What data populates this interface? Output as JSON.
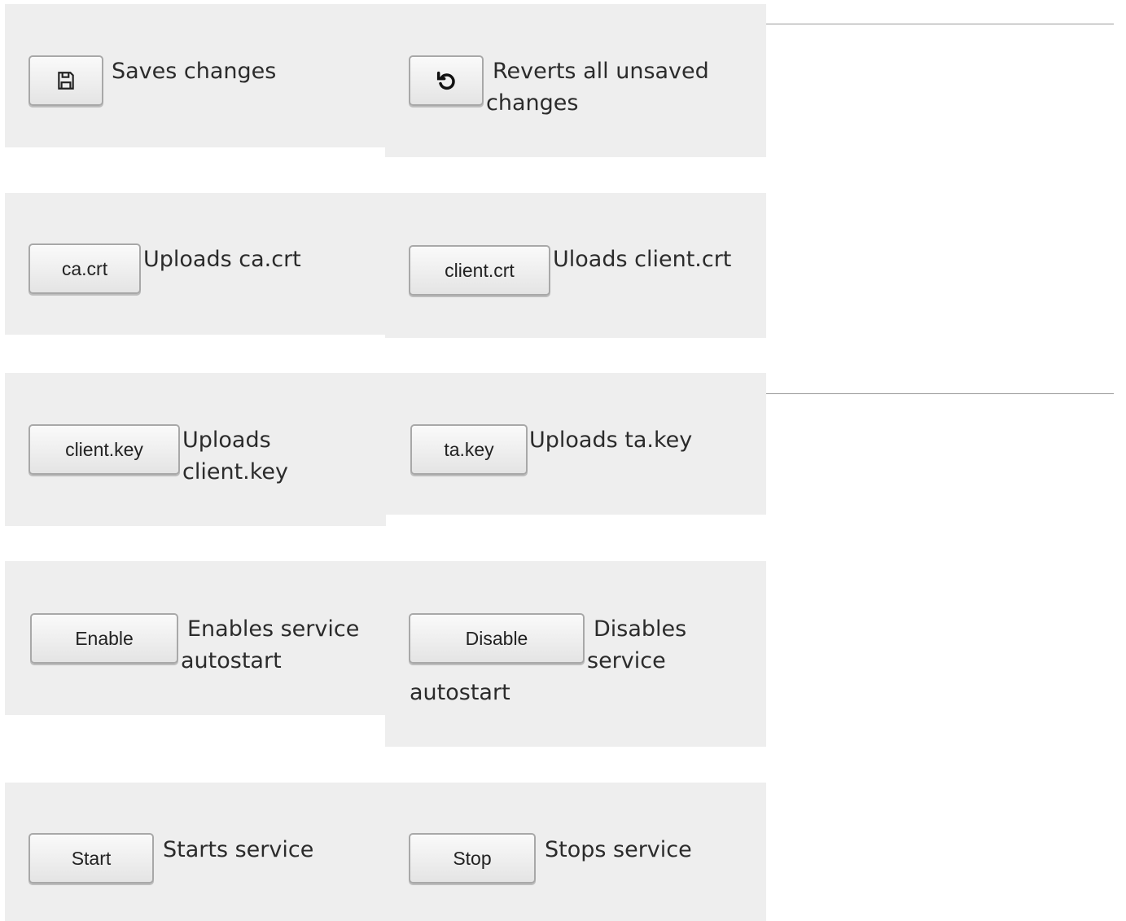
{
  "rows": [
    {
      "left": {
        "button_icon": "save-icon",
        "description": "Saves changes"
      },
      "right": {
        "button_icon": "undo-icon",
        "description": "Reverts all unsaved changes"
      }
    },
    {
      "left": {
        "button_label": "ca.crt",
        "description": "Uploads ca.crt"
      },
      "right": {
        "button_label": "client.crt",
        "description": "Uloads client.crt"
      }
    },
    {
      "left": {
        "button_label": "client.key",
        "description": "Uploads client.key"
      },
      "right": {
        "button_label": "ta.key",
        "description": "Uploads ta.key"
      }
    },
    {
      "left": {
        "button_label": "Enable",
        "description": "Enables service autostart"
      },
      "right": {
        "button_label": "Disable",
        "description": "Disables service autostart"
      }
    },
    {
      "left": {
        "button_label": "Start",
        "description": "Starts service"
      },
      "right": {
        "button_label": "Stop",
        "description": "Stops service"
      }
    }
  ],
  "colors": {
    "cell_background": "#eeeeee",
    "divider": "#999999"
  }
}
